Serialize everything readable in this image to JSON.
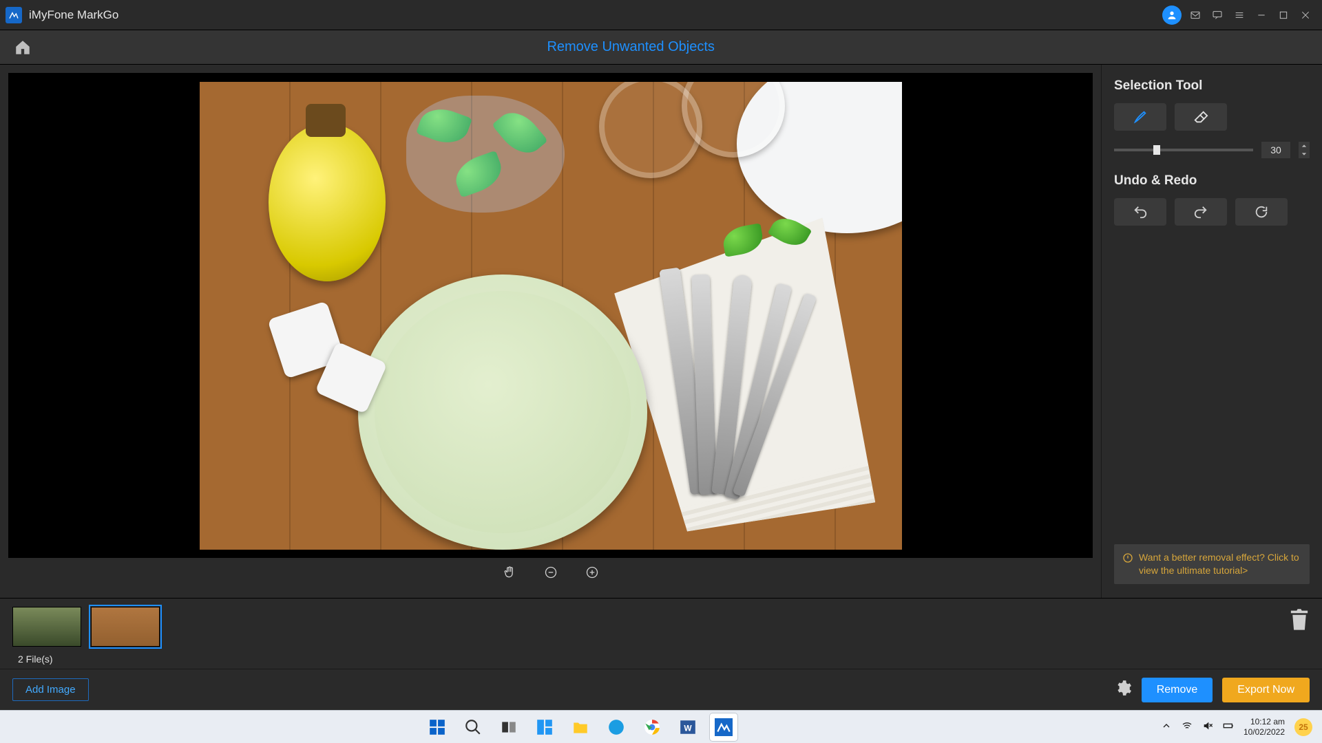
{
  "titlebar": {
    "app_name": "iMyFone MarkGo"
  },
  "header": {
    "mode_title": "Remove Unwanted Objects"
  },
  "side": {
    "selection_heading": "Selection Tool",
    "brush_size": "30",
    "undo_heading": "Undo & Redo",
    "tip_text": "Want a better removal effect? Click to view the ultimate tutorial>"
  },
  "strip": {
    "file_count": "2 File(s)",
    "add_image_label": "Add Image"
  },
  "actions": {
    "remove": "Remove",
    "export": "Export Now"
  },
  "taskbar": {
    "time": "10:12 am",
    "date": "10/02/2022",
    "temp": "25"
  }
}
